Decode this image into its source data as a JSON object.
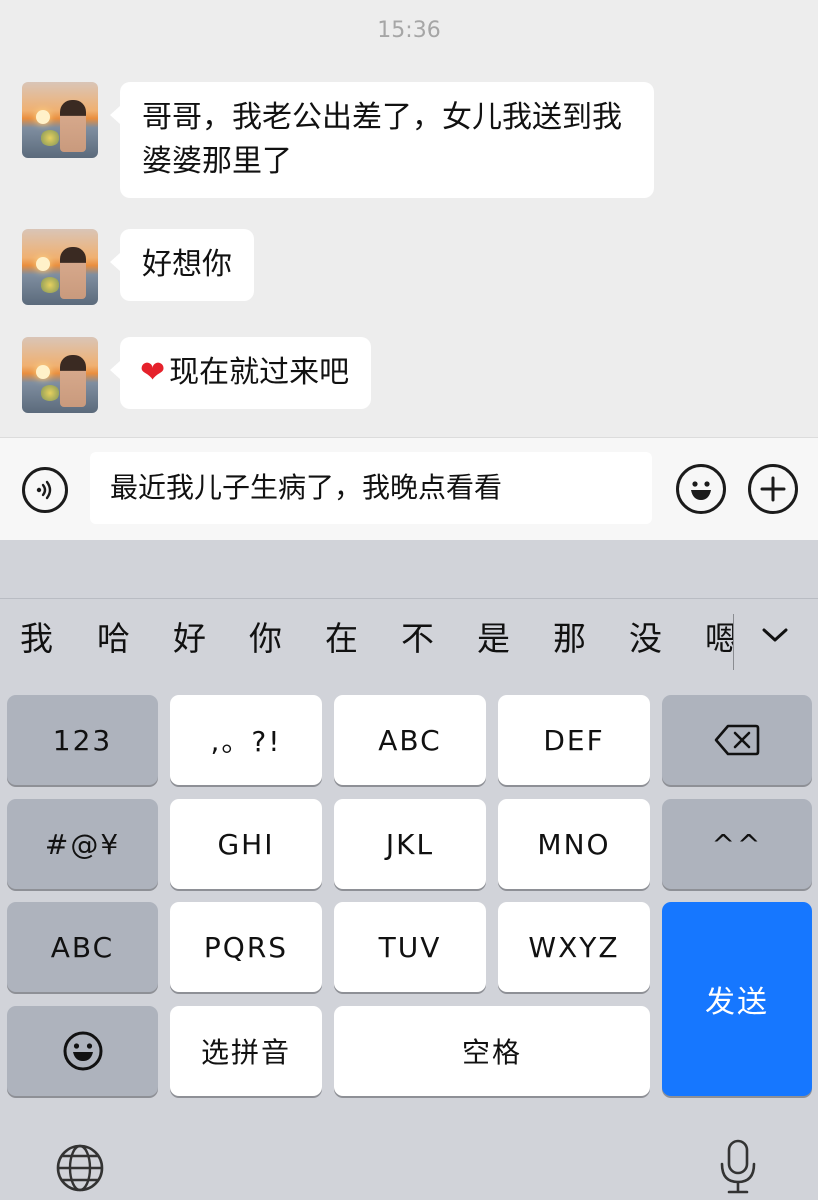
{
  "chat": {
    "timestamp": "15:36",
    "messages": [
      {
        "text": "哥哥，我老公出差了，女儿我送到我婆婆那里了"
      },
      {
        "text": "好想你"
      },
      {
        "emoji": "❤",
        "text": "现在就过来吧"
      }
    ]
  },
  "input": {
    "value": "最近我儿子生病了，我晚点看看",
    "voice_icon": "voice-icon",
    "emoji_icon": "emoji-icon",
    "add_icon": "plus-icon"
  },
  "candidates": [
    "我",
    "哈",
    "好",
    "你",
    "在",
    "不",
    "是",
    "那",
    "没",
    "嗯"
  ],
  "keys": {
    "k123": "123",
    "punct": ",。?!",
    "abc": "ABC",
    "def": "DEF",
    "symbols": "#@¥",
    "ghi": "GHI",
    "jkl": "JKL",
    "mno": "MNO",
    "emoticon": "^^",
    "abc_mode": "ABC",
    "pqrs": "PQRS",
    "tuv": "TUV",
    "wxyz": "WXYZ",
    "send": "发送",
    "select_pinyin": "选拼音",
    "space": "空格"
  },
  "colors": {
    "chat_bg": "#ededed",
    "bubble": "#ffffff",
    "send_key": "#1677ff",
    "keyboard_bg": "#d1d3d9",
    "function_key": "#aeb3bd"
  }
}
